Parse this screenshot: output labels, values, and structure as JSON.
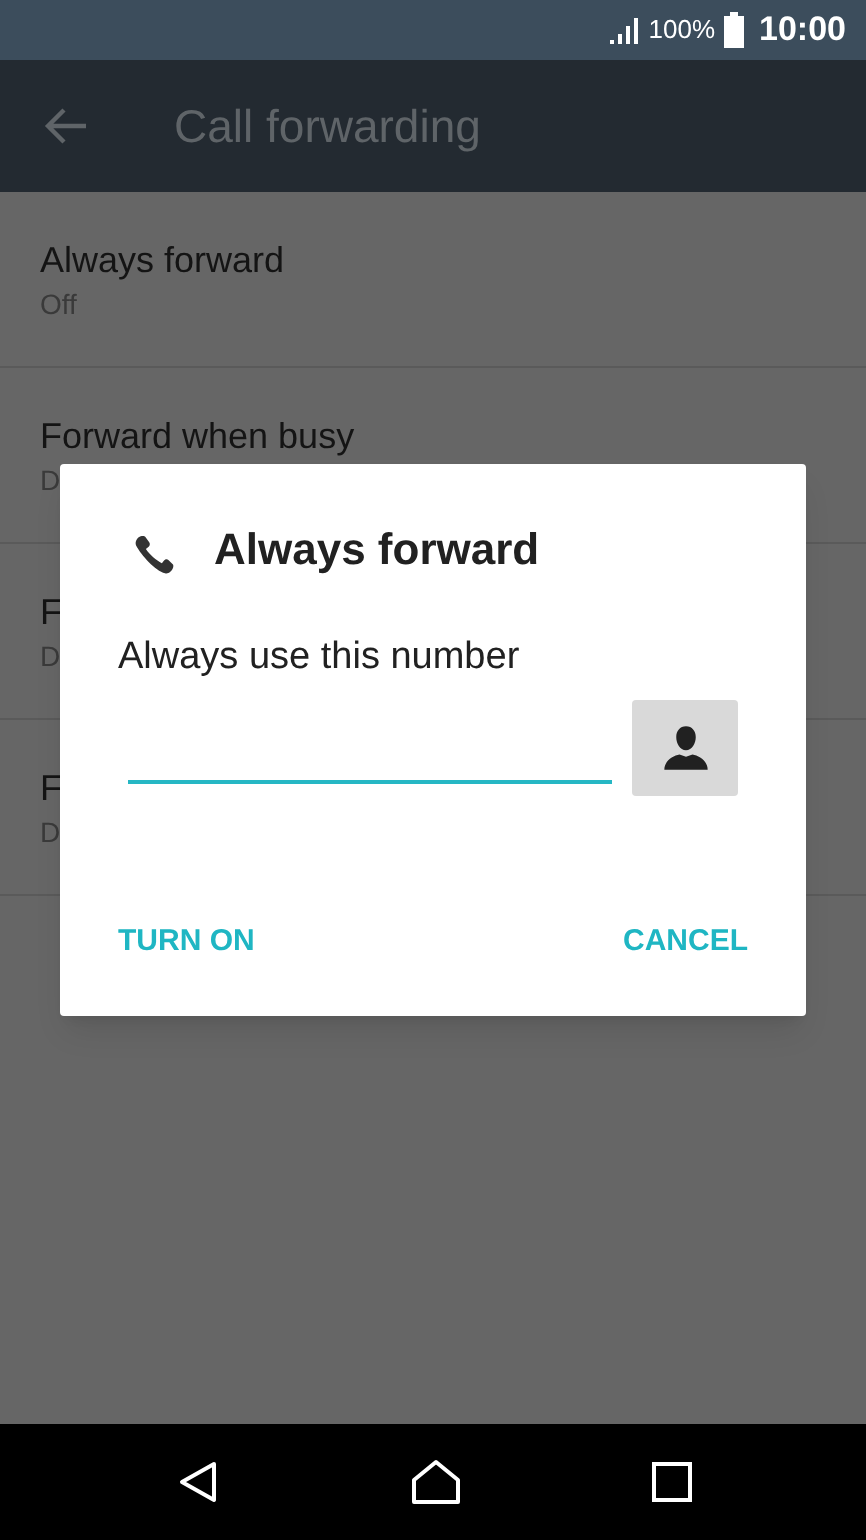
{
  "status_bar": {
    "battery": "100%",
    "time": "10:00"
  },
  "toolbar": {
    "title": "Call forwarding"
  },
  "settings": [
    {
      "title": "Always forward",
      "subtitle": "Off"
    },
    {
      "title": "Forward when busy",
      "subtitle": "D"
    },
    {
      "title": "F",
      "subtitle": "D"
    },
    {
      "title": "F",
      "subtitle": "D"
    }
  ],
  "dialog": {
    "title": "Always forward",
    "label": "Always use this number",
    "field": {
      "focused": true
    },
    "buttons": [
      "TURN ON",
      "CANCEL"
    ]
  }
}
